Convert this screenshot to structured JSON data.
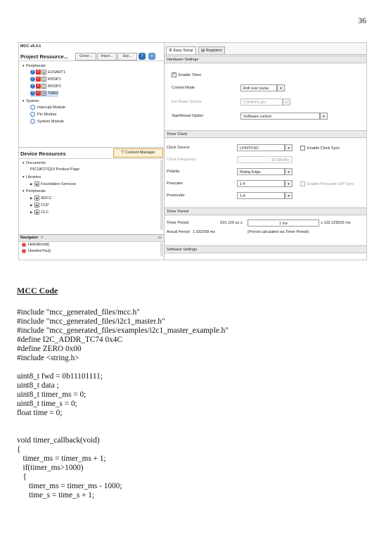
{
  "page_number": "36",
  "screenshot": {
    "version": "MCC v5.4.1",
    "project_resources": {
      "title": "Project Resource...",
      "buttons": [
        "Gener...",
        "Impor...",
        "Exp..."
      ],
      "tree": [
        {
          "label": "Peripherals",
          "level": 0,
          "kind": "folder"
        },
        {
          "label": "EUSART1",
          "level": 1,
          "kind": "periph"
        },
        {
          "label": "MSSP1",
          "level": 1,
          "kind": "periph"
        },
        {
          "label": "MSSP2",
          "level": 1,
          "kind": "periph"
        },
        {
          "label": "TMR2",
          "level": 1,
          "kind": "periph",
          "selected": true
        },
        {
          "label": "System",
          "level": 0,
          "kind": "folder"
        },
        {
          "label": "Interrupt Module",
          "level": 1,
          "kind": "sys"
        },
        {
          "label": "Pin Module",
          "level": 1,
          "kind": "sys"
        },
        {
          "label": "System Module",
          "level": 1,
          "kind": "sys"
        }
      ]
    },
    "device_resources": {
      "title": "Device Resources",
      "content_manager": "Content Manager",
      "tree": [
        {
          "label": "Documents",
          "level": 0,
          "kind": "folder"
        },
        {
          "label": "PIC18F27Q10 Product Page",
          "level": 1,
          "kind": "plain"
        },
        {
          "label": "Libraries",
          "level": 0,
          "kind": "folder"
        },
        {
          "label": "Foundation Services",
          "level": 1,
          "kind": "lib"
        },
        {
          "label": "Peripherals",
          "level": 0,
          "kind": "folder"
        },
        {
          "label": "ADCC",
          "level": 1,
          "kind": "lib"
        },
        {
          "label": "CCP",
          "level": 1,
          "kind": "lib"
        },
        {
          "label": "CLC",
          "level": 1,
          "kind": "lib"
        }
      ]
    },
    "navigator": {
      "title": "Navigator",
      "close": "×",
      "items": [
        "HelloWorld()",
        "HowAreYou()"
      ]
    },
    "tabs": [
      "Easy Setup",
      "Registers"
    ],
    "hardware_settings": {
      "title": "Hardware Settings",
      "enable_timer": "Enable Timer",
      "control_mode_label": "Control Mode",
      "control_mode_value": "Roll over pulse",
      "ext_reset_label": "Ext Reset Source",
      "ext_reset_value": "T2INPPS pin",
      "start_reset_label": "Start/Reset Option",
      "start_reset_value": "Software control"
    },
    "timer_clock": {
      "title": "Timer Clock",
      "clock_source_label": "Clock Source",
      "clock_source_value": "LFINTOSC",
      "enable_clock_sync": "Enable Clock Sync",
      "clock_freq_label": "Clock Frequency",
      "clock_freq_value": "32.768 kHz",
      "polarity_label": "Polarity",
      "polarity_value": "Rising Edge",
      "prescaler_label": "Prescaler",
      "prescaler_value": "1:4",
      "enable_prescaler_sync": "Enable Prescaler O/P Sync",
      "postscaler_label": "Postscaler",
      "postscaler_value": "1:4"
    },
    "timer_period": {
      "title": "Timer Period",
      "label": "Timer Period",
      "min": "516.129 us ≤",
      "value": "1 ms",
      "max": "≤ 132.129032 ms",
      "actual_label": "Actual Period",
      "actual_value": "1.032258 ms",
      "note": "(Period calculated via Timer Period)"
    },
    "software_settings": {
      "title": "Software Settings"
    }
  },
  "heading": "MCC Code",
  "code_lines": [
    "#include \"mcc_generated_files/mcc.h\"",
    "#include \"mcc_generated_files/i2c1_master.h\"",
    "#include \"mcc_generated_files/examples/i2c1_master_example.h\"",
    "#define I2C_ADDR_TC74 0x4C",
    "#define ZERO 0x00",
    "#include <string.h>",
    "",
    "uint8_t fwd = 0b11101111;",
    "uint8_t data ;",
    "uint8_t timer_ms = 0;",
    "uint8_t time_s = 0;",
    "float time = 0;",
    "",
    "",
    "void timer_callback(void)",
    "{",
    "   timer_ms = timer_ms + 1;",
    "   if(timer_ms>1000)",
    "   {",
    "      timer_ms = timer_ms - 1000;",
    "      time_s = time_s + 1;"
  ]
}
